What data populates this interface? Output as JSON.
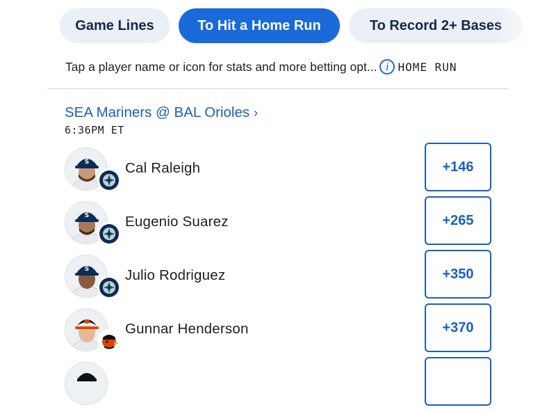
{
  "tabs": [
    {
      "label": "Game Lines",
      "active": false
    },
    {
      "label": "To Hit a Home Run",
      "active": true
    },
    {
      "label": "To Record 2+ Bases",
      "active": false
    }
  ],
  "subheader": {
    "hint": "Tap a player name or icon for stats and more betting opt...",
    "info_icon": "info-icon",
    "market_label": "HOME RUN"
  },
  "game": {
    "matchup": "SEA Mariners @ BAL Orioles",
    "time": "6:36PM ET"
  },
  "players": [
    {
      "name": "Cal Raleigh",
      "odds": "+146",
      "team": "mariners"
    },
    {
      "name": "Eugenio Suarez",
      "odds": "+265",
      "team": "mariners"
    },
    {
      "name": "Julio Rodriguez",
      "odds": "+350",
      "team": "mariners"
    },
    {
      "name": "Gunnar Henderson",
      "odds": "+370",
      "team": "orioles"
    }
  ],
  "colors": {
    "accent": "#1a6ad9",
    "link": "#1a5fc2",
    "tab_inactive_bg": "#eaf0f6",
    "mariners_navy": "#0c2c56",
    "mariners_teal": "#005c5c",
    "orioles_orange": "#df4601"
  }
}
